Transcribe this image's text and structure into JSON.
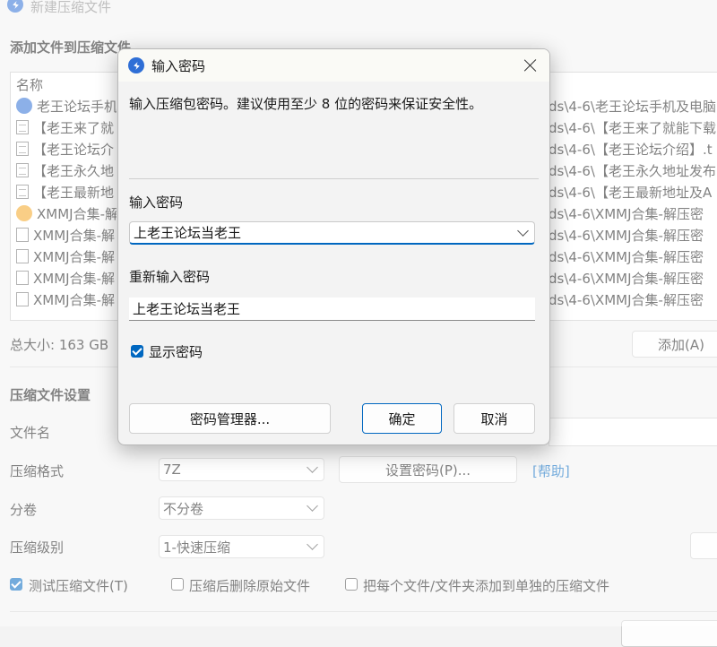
{
  "window": {
    "title": "新建压缩文件"
  },
  "add_section": {
    "title": "添加文件到压缩文件",
    "column_name": "名称"
  },
  "files": [
    {
      "name": "老王论坛手机",
      "path": "ds\\4-6\\老王论坛手机及电脑",
      "icon": "archive-icon"
    },
    {
      "name": "【老王来了就",
      "path": "ds\\4-6\\【老王来了就能下载",
      "icon": "document-icon"
    },
    {
      "name": "【老王论坛介",
      "path": "ds\\4-6\\【老王论坛介绍】.t",
      "icon": "document-icon"
    },
    {
      "name": "【老王永久地",
      "path": "ds\\4-6\\【老王永久地址发布",
      "icon": "document-icon"
    },
    {
      "name": "【老王最新地",
      "path": "ds\\4-6\\【老王最新地址及A",
      "icon": "document-icon"
    },
    {
      "name": "XMMJ合集-解",
      "path": "ds\\4-6\\XMMJ合集-解压密",
      "icon": "special-file-icon"
    },
    {
      "name": "XMMJ合集-解",
      "path": "ds\\4-6\\XMMJ合集-解压密",
      "icon": "file-icon"
    },
    {
      "name": "XMMJ合集-解",
      "path": "ds\\4-6\\XMMJ合集-解压密",
      "icon": "file-icon"
    },
    {
      "name": "XMMJ合集-解",
      "path": "ds\\4-6\\XMMJ合集-解压密",
      "icon": "file-icon"
    },
    {
      "name": "XMMJ合集-解",
      "path": "ds\\4-6\\XMMJ合集-解压密",
      "icon": "file-icon"
    }
  ],
  "total_size": "总大小: 163 GB",
  "add_button": "添加(A)",
  "settings": {
    "title": "压缩文件设置",
    "filename_label": "文件名",
    "format_label": "压缩格式",
    "format_value": "7Z",
    "set_password_button": "设置密码(P)...",
    "help_link": "[帮助]",
    "volume_label": "分卷",
    "volume_value": "不分卷",
    "level_label": "压缩级别",
    "level_value": "1-快速压缩",
    "test_label": "测试压缩文件(T)",
    "delete_label": "压缩后删除原始文件",
    "separate_label": "把每个文件/文件夹添加到单独的压缩文件"
  },
  "dialog": {
    "title": "输入密码",
    "description": "输入压缩包密码。建议使用至少 8 位的密码来保证安全性。",
    "password_label": "输入密码",
    "password_value": "上老王论坛当老王",
    "reenter_label": "重新输入密码",
    "reenter_value": "上老王论坛当老王",
    "show_password_label": "显示密码",
    "password_manager_button": "密码管理器...",
    "ok_button": "确定",
    "cancel_button": "取消"
  },
  "colors": {
    "accent": "#0067c0",
    "app_icon": "#2f6fd6",
    "help_link": "#0067c0"
  }
}
